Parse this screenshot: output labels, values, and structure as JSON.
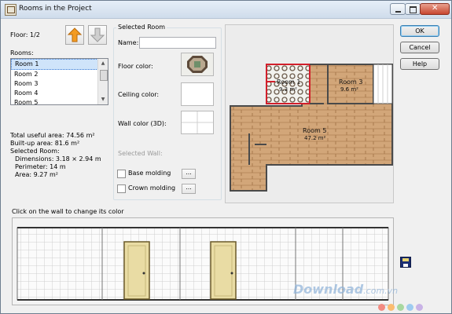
{
  "window": {
    "title": "Rooms in the Project"
  },
  "left": {
    "floor_label": "Floor: 1/2",
    "rooms_label": "Rooms:",
    "rooms": [
      "Room 1",
      "Room 2",
      "Room 3",
      "Room 4",
      "Room 5"
    ],
    "selected_room": "Room 1",
    "stats": [
      "Total useful area: 74.56 m²",
      "Built-up area: 81.6 m²",
      "Selected Room:",
      "Dimensions: 3.18 × 2.94 m",
      "Perimeter: 14 m",
      "Area: 9.27 m²"
    ]
  },
  "selected_room_group": {
    "title": "Selected Room",
    "name_label": "Name:",
    "name_value": "",
    "floor_color_label": "Floor color:",
    "ceiling_color_label": "Ceiling color:",
    "wall_color_label": "Wall color (3D):",
    "selected_wall_label": "Selected Wall:",
    "base_molding_label": "Base molding",
    "crown_molding_label": "Crown molding",
    "browse_label": "..."
  },
  "plan": {
    "rooms": [
      {
        "name": "Room 1",
        "area": "9.3 m²"
      },
      {
        "name": "Room 3",
        "area": "9.6 m²"
      },
      {
        "name": "Room 5",
        "area": "47.2 m²"
      }
    ]
  },
  "buttons": {
    "ok": "OK",
    "cancel": "Cancel",
    "help": "Help"
  },
  "elevation": {
    "hint": "Click on the wall to change its color"
  },
  "watermark": {
    "text": "Download",
    "suffix": ".com.vn"
  },
  "colors": {
    "accent": "#3c7fb1",
    "wood": "#d2a679",
    "selected_wall": "#d21f2b",
    "arrow_up": "#f39b21"
  }
}
